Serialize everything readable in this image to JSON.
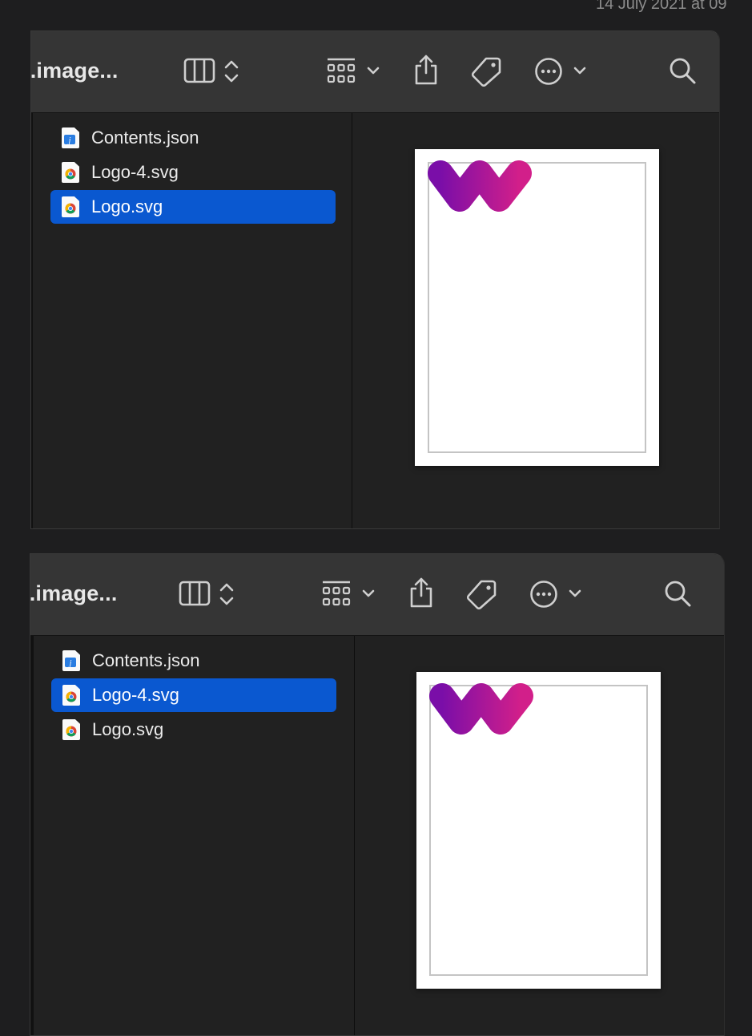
{
  "timestamp": "14 July 2021 at 09",
  "windows": [
    {
      "title": "o.image...",
      "files": [
        {
          "name": "Contents.json",
          "type": "json",
          "selected": false
        },
        {
          "name": "Logo-4.svg",
          "type": "svg",
          "selected": false
        },
        {
          "name": "Logo.svg",
          "type": "svg",
          "selected": true
        }
      ]
    },
    {
      "title": "o.image...",
      "files": [
        {
          "name": "Contents.json",
          "type": "json",
          "selected": false
        },
        {
          "name": "Logo-4.svg",
          "type": "svg",
          "selected": true
        },
        {
          "name": "Logo.svg",
          "type": "svg",
          "selected": false
        }
      ]
    }
  ],
  "colors": {
    "selection": "#0a58d0",
    "logo_gradient_start": "#7a0ea8",
    "logo_gradient_end": "#d21f8a"
  },
  "toolbar_icons": [
    "columns-view-icon",
    "view-switch-chevrons-icon",
    "group-grid-icon",
    "chevron-down-icon",
    "share-icon",
    "tag-icon",
    "more-icon",
    "search-icon"
  ]
}
